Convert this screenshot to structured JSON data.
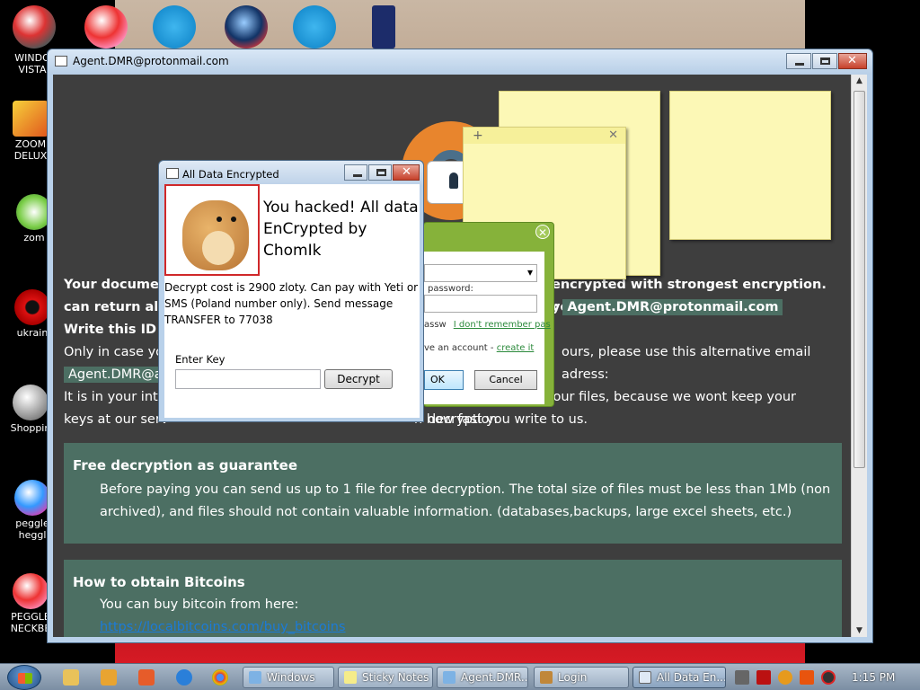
{
  "desktop": {
    "icons": [
      {
        "label": "WINDO\nVISTA",
        "name": "windows-vista-icon"
      },
      {
        "label": "ZOOM\nDELUX",
        "name": "zoom-deluxe-icon"
      },
      {
        "label": "zom",
        "name": "zombie-icon"
      },
      {
        "label": "ukrain",
        "name": "ukraine-icon"
      },
      {
        "label": "Shoppin",
        "name": "shopping-icon"
      },
      {
        "label": "peggle\nheggl",
        "name": "peggle-icon"
      },
      {
        "label": "PEGGLE\nNECKBE",
        "name": "peggle-neckbeard-icon"
      }
    ]
  },
  "browser": {
    "title": "Agent.DMR@protonmail.com",
    "ransom": {
      "line1a": "Your documen",
      "line1b": "encrypted with strongest encryption. you",
      "line2a": "can return all",
      "line2b": "l:",
      "email_primary": "Agent.DMR@protonmail.com",
      "line3a": "Write this ID i",
      "line4a": "Only in case you",
      "line4b": "ours, please use this alternative email adress:",
      "email_alt": "Agent.DMR@ac",
      "line5a": "It is in your inter",
      "line5b": "the restoration of your files, because we wont keep your decryption",
      "line6a": "keys at our serv",
      "line6b": "n how fast you write to us."
    },
    "free_panel": {
      "heading": "Free decryption as guarantee",
      "text": "Before paying you can send us up to 1 file for free decryption. The total size of files must be less than 1Mb (non archived), and files should not contain valuable information. (databases,backups, large excel sheets, etc.)"
    },
    "bitcoin_panel": {
      "heading": "How to obtain Bitcoins",
      "text": "You can buy bitcoin from here:",
      "link": "https://localbitcoins.com/buy_bitcoins"
    },
    "background_text": "ted"
  },
  "login_dialog": {
    "password_label": "password:",
    "remember_prefix": "assw",
    "remember_link": "I don't remember pas",
    "account_prefix": "ve an account -",
    "account_link": "create it",
    "ok_label": "OK",
    "cancel_label": "Cancel",
    "close_glyph": "✕"
  },
  "sticky_note": {
    "plus": "+",
    "close": "✕"
  },
  "ade_dialog": {
    "title": "All Data Encrypted",
    "headline": "You hacked! All data EnCrypted by ChomIk",
    "description": "Decrypt cost is 2900 zloty. Can pay with Yeti or SMS (Poland number only). Send message TRANSFER to 77038",
    "key_label": "Enter Key",
    "key_value": "",
    "decrypt_label": "Decrypt"
  },
  "taskbar": {
    "tasks": [
      {
        "label": "Windows",
        "name": "task-windows"
      },
      {
        "label": "Sticky Notes",
        "name": "task-sticky-notes"
      },
      {
        "label": "Agent.DMR...",
        "name": "task-agent-dmr"
      },
      {
        "label": "Login",
        "name": "task-login"
      },
      {
        "label": "All Data En...",
        "name": "task-all-data-encrypted"
      }
    ],
    "clock": "1:15 PM"
  },
  "colors": {
    "ransom_background": "#3e3e3e",
    "panel_green": "#4c6f63",
    "link_blue": "#1b7bd8",
    "dialog_red_border": "#d0282a",
    "login_green": "#86b23a"
  }
}
